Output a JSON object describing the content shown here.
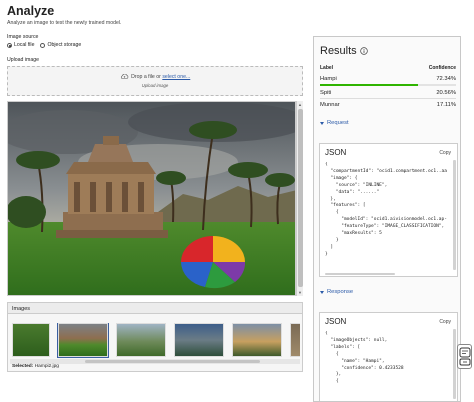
{
  "header": {
    "title": "Analyze",
    "subtitle": "Analyze an image to test the newly trained model."
  },
  "image_source": {
    "label": "Image source",
    "options": [
      {
        "label": "Local file",
        "selected": true
      },
      {
        "label": "Object storage",
        "selected": false
      }
    ]
  },
  "upload": {
    "label": "Upload image",
    "drop_text": "Drop a file or",
    "select_link": "select one...",
    "note": "Upload image"
  },
  "images_panel": {
    "title": "Images",
    "selected_label": "Selected:",
    "selected_value": "Hampi2.jpg"
  },
  "results": {
    "title": "Results",
    "columns": {
      "label": "Label",
      "confidence": "Confidence"
    },
    "rows": [
      {
        "label": "Hampi",
        "confidence": "72.34%",
        "fraction": 0.7234
      },
      {
        "label": "Spiti",
        "confidence": "20.56%"
      },
      {
        "label": "Munnar",
        "confidence": "17.11%"
      }
    ],
    "bar_color": "#2fb400"
  },
  "request": {
    "toggle_label": "Request",
    "json_title": "JSON",
    "copy_label": "Copy",
    "code": "{\n  \"compartmentId\": \"ocid1.compartment.oc1..aa\n  \"image\": {\n    \"source\": \"INLINE\",\n    \"data\": \"......\"\n  },\n  \"features\": [\n    {\n      \"modelId\": \"ocid1.aivisionmodel.oc1.ap-\n      \"featureType\": \"IMAGE_CLASSIFICATION\",\n      \"maxResults\": 5\n    }\n  ]\n}"
  },
  "response": {
    "toggle_label": "Response",
    "json_title": "JSON",
    "copy_label": "Copy",
    "code": "{\n  \"imageObjects\": null,\n  \"labels\": [\n    {\n      \"name\": \"Hampi\",\n      \"confidence\": 0.4233528\n    },\n    {"
  },
  "colors": {
    "link": "#2b5aa8",
    "accent_green": "#2fb400"
  }
}
